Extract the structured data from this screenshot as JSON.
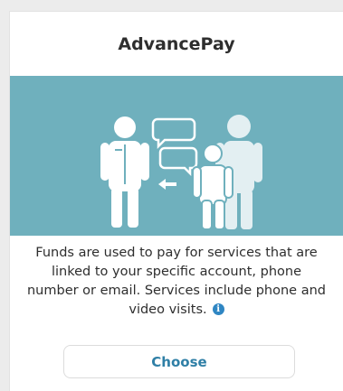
{
  "card": {
    "title": "AdvancePay",
    "illustration_icon": "people-transfer-illustration",
    "description": "Funds are used to pay for services that are linked to your specific account, phone number or email. Services include phone and video visits.",
    "info_icon_glyph": "i",
    "choose_label": "Choose"
  },
  "colors": {
    "banner": "#6fb0bd",
    "illustration": "#ffffff",
    "info_icon": "#2f86c3",
    "button_text": "#2f7fa6"
  }
}
